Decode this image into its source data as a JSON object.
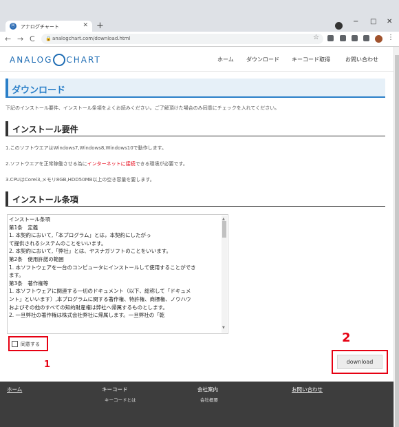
{
  "browser": {
    "tab_title": "アナログチャート",
    "favicon": "Ⓐ",
    "url": "analogchart.com/download.html",
    "new_tab": "+",
    "minimize": "−",
    "restore": "□",
    "close": "✕",
    "tab_close": "✕",
    "back": "←",
    "forward": "→",
    "reload": "C",
    "star": "☆",
    "menu": "⋮",
    "avatar_color": "#a0522d"
  },
  "header": {
    "logo_left": "ANALOG",
    "logo_right": "CHART",
    "nav": [
      "ホーム",
      "ダウンロード",
      "キーコード取得",
      "お問い合わせ"
    ]
  },
  "main": {
    "page_title": "ダウンロード",
    "intro": "下記のインストール要件、インストール条項をよくお読みください。ご了解頂けた場合のみ同意にチェックを入れてください。",
    "requirements_title": "インストール要件",
    "requirements": {
      "r1": "1.このソフトウエアはWindows7,Windows8,Windows10で動作します。",
      "r2_a": "2.ソフトウエアを正常稼働させる為に",
      "r2_b": "インターネットに接続",
      "r2_c": "できる環境が必要です。",
      "r3": "3.CPUはCorei3,メモリ8GB,HDD50MB以上の空き容量を要します。"
    },
    "terms_title": "インストール条項",
    "terms_lines": [
      "インストール条項",
      "第1条　定義",
      "1. 本契約において,「本プログラム」とは，本契約にしたがっ",
      "て提供されるシステムのことをいいます。",
      "2. 本契約において,「弊社」とは、ヤスナガソフトのことをいいます。",
      "第2条　使用許諾の範囲",
      "1. 本ソフトウェアを一台のコンピュータにインストールして使用することができ",
      "ます。",
      "第3条　著作権等",
      "1. 本ソフトウェアに関連する一切のドキュメント（以下、総称して「ドキュメ",
      "ント」といいます）,本プログラムに関する著作権、特許権、商標権、ノウハウ",
      "およびその他のすべての知的財産権は弊社へ帰属するものとします。",
      "2. 一旦弊社の著作権は株式会社弊社に帰属します。一旦弊社の「乾"
    ],
    "agree_label": "同意する",
    "download_label": "download",
    "annotation_1": "1",
    "annotation_2": "2"
  },
  "footer": {
    "col1": "ホーム",
    "col2": "キーコード",
    "col2_sub": "キーコードとは",
    "col3": "会社案内",
    "col3_sub": "会社概要",
    "col4": "お問い合わせ"
  }
}
